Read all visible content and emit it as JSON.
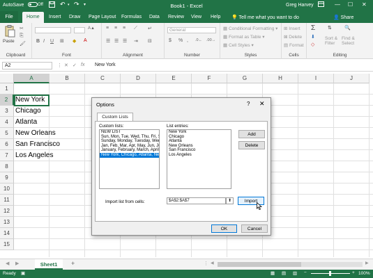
{
  "titlebar": {
    "autosave_label": "AutoSave",
    "autosave_state": "Off",
    "save_icon": "save-icon",
    "undo_icon": "undo-icon",
    "redo_icon": "redo-icon",
    "customize_icon": "customize-qat-icon",
    "title": "Book1  -  Excel",
    "user": "Greg Harvey",
    "window_controls": [
      "—",
      "☐",
      "✕"
    ],
    "ribbon_display_icon": "ribbon-display-icon"
  },
  "tabs": [
    "File",
    "Home",
    "Insert",
    "Draw",
    "Page Layout",
    "Formulas",
    "Data",
    "Review",
    "View",
    "Help"
  ],
  "active_tab": "Home",
  "tell_me": "Tell me what you want to do",
  "share": "Share",
  "ribbon": {
    "clipboard": {
      "label": "Clipboard",
      "paste": "Paste"
    },
    "font": {
      "label": "Font",
      "bold": "B",
      "italic": "I",
      "underline": "U"
    },
    "alignment": {
      "label": "Alignment"
    },
    "number": {
      "label": "Number",
      "format": "General",
      "currency": "$",
      "percent": "%",
      "comma": ","
    },
    "styles": {
      "label": "Styles",
      "items": [
        "Conditional Formatting",
        "Format as Table",
        "Cell Styles"
      ]
    },
    "cells": {
      "label": "Cells",
      "items": [
        "Insert",
        "Delete",
        "Format"
      ]
    },
    "editing": {
      "label": "Editing",
      "sort_filter": "Sort &\nFilter",
      "find_select": "Find &\nSelect",
      "sum": "Σ"
    }
  },
  "formula_bar": {
    "name_box": "A2",
    "fx": "fx",
    "content": "New York"
  },
  "grid": {
    "columns": [
      "A",
      "B",
      "C",
      "D",
      "E",
      "F",
      "G",
      "H",
      "I",
      "J"
    ],
    "rows": [
      "1",
      "2",
      "3",
      "4",
      "5",
      "6",
      "7",
      "8",
      "9",
      "10",
      "11",
      "12",
      "13",
      "14",
      "15"
    ],
    "selected_column": "A",
    "selected_row": "2",
    "cells": [
      "New York",
      "Chicago",
      "Atlanta",
      "New Orleans",
      "San Francisco",
      "Los Angeles"
    ]
  },
  "sheets": [
    "Sheet1"
  ],
  "add_sheet": "+",
  "status": {
    "ready": "Ready",
    "zoom": "100%"
  },
  "dialog": {
    "title": "Options",
    "help": "?",
    "close": "✕",
    "tab": "Custom Lists",
    "custom_lists_label": "Custom lists:",
    "custom_lists": [
      "NEW LIST",
      "Sun, Mon, Tue, Wed, Thu, Fri, S",
      "Sunday, Monday, Tuesday, Wed",
      "Jan, Feb, Mar, Apr, May, Jun, Ju",
      "January, February, March, April",
      "New York, Chicago, Atlanta, Ne"
    ],
    "selected_list_index": 5,
    "list_entries_label": "List entries:",
    "list_entries": [
      "New York",
      "Chicago",
      "Atlanta",
      "New Orleans",
      "San Francisco",
      "Los Angeles"
    ],
    "add_button": "Add",
    "delete_button": "Delete",
    "import_label": "Import list from cells:",
    "import_value": "$A$2:$A$7",
    "import_button": "Import",
    "ok_button": "OK",
    "cancel_button": "Cancel"
  }
}
